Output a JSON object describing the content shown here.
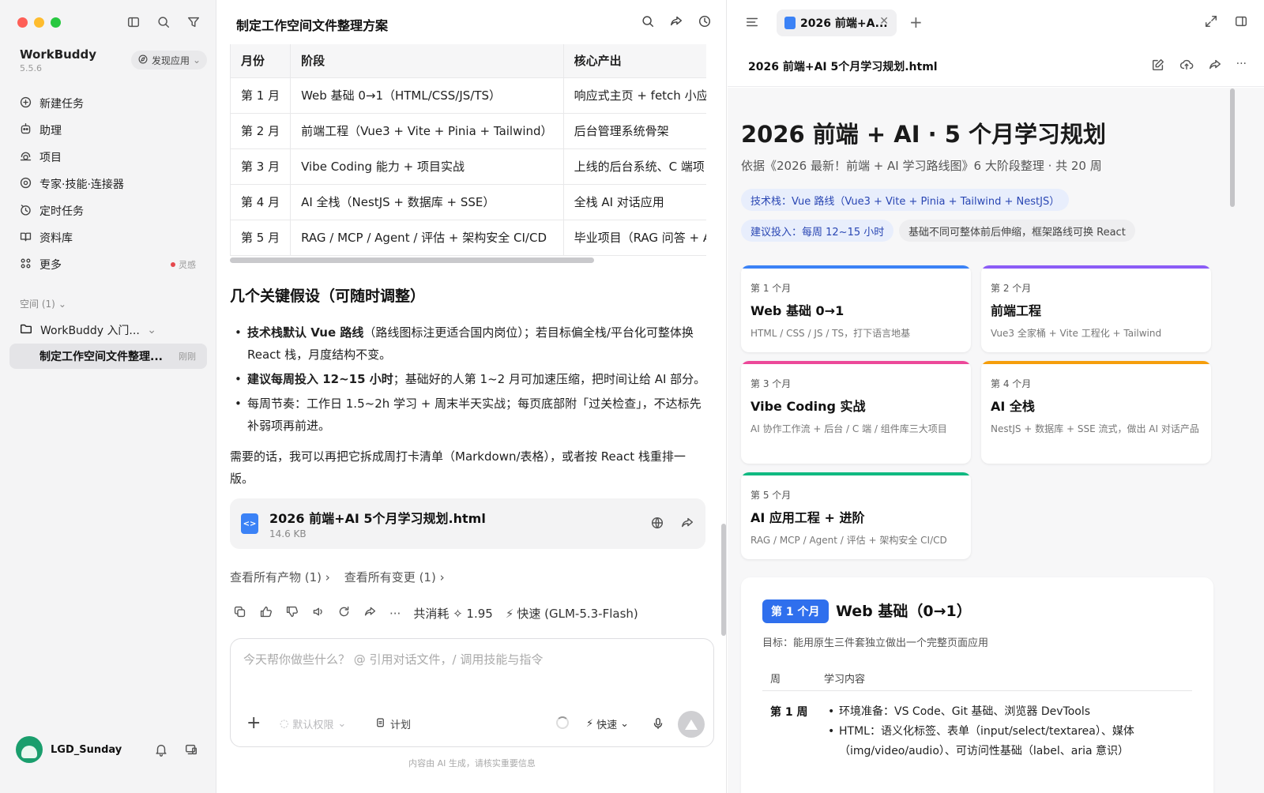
{
  "sidebar": {
    "brand": "WorkBuddy",
    "version": "5.5.6",
    "discover_label": "发现应用",
    "nav": [
      {
        "label": "新建任务"
      },
      {
        "label": "助理"
      },
      {
        "label": "项目"
      },
      {
        "label": "专家·技能·连接器"
      },
      {
        "label": "定时任务"
      },
      {
        "label": "资料库"
      },
      {
        "label": "更多",
        "badge": "灵感"
      }
    ],
    "space_label": "空间 (1)",
    "folder_label": "WorkBuddy 入门...",
    "task": {
      "label": "制定工作空间文件整理...",
      "time": "刚刚"
    },
    "user": {
      "name": "LGD_Sunday"
    }
  },
  "chat": {
    "title": "制定工作空间文件整理方案",
    "table": {
      "headers": [
        "月份",
        "阶段",
        "核心产出"
      ],
      "rows": [
        [
          "第 1 月",
          "Web 基础 0→1（HTML/CSS/JS/TS）",
          "响应式主页 + fetch 小应用"
        ],
        [
          "第 2 月",
          "前端工程（Vue3 + Vite + Pinia + Tailwind）",
          "后台管理系统骨架"
        ],
        [
          "第 3 月",
          "Vibe Coding 能力 + 项目实战",
          "上线的后台系统、C 端项目"
        ],
        [
          "第 4 月",
          "AI 全栈（NestJS + 数据库 + SSE）",
          "全栈 AI 对话应用"
        ],
        [
          "第 5 月",
          "RAG / MCP / Agent / 评估 + 架构安全 CI/CD",
          "毕业项目（RAG 问答 + Age"
        ]
      ]
    },
    "assumptions_title": "几个关键假设（可随时调整）",
    "bullets": [
      {
        "bold": "技术栈默认 Vue 路线",
        "text": "（路线图标注更适合国内岗位）；若目标偏全栈/平台化可整体换 React 栈，月度结构不变。"
      },
      {
        "bold": "建议每周投入 12~15 小时",
        "text": "；基础好的人第 1~2 月可加速压缩，把时间让给 AI 部分。"
      },
      {
        "bold": "",
        "text": "每周节奏：工作日 1.5~2h 学习 + 周末半天实战；每页底部附「过关检查」，不达标先补弱项再前进。"
      }
    ],
    "closing": "需要的话，我可以再把它拆成周打卡清单（Markdown/表格），或者按 React 栈重排一版。",
    "file": {
      "name": "2026 前端+AI 5个月学习规划.html",
      "size": "14.6 KB"
    },
    "links": [
      "查看所有产物 (1) ›",
      "查看所有变更 (1) ›"
    ],
    "cost": "共消耗 ✧ 1.95",
    "model": "快速 (GLM-5.3-Flash)",
    "composer": {
      "placeholder": "今天帮你做些什么？ @ 引用对话文件，/ 调用技能与指令",
      "perm_label": "默认权限",
      "plan_label": "计划",
      "speed_label": "快速"
    },
    "disclaimer": "内容由 AI 生成，请核实重要信息"
  },
  "preview": {
    "tab_label": "2026 前端+A...",
    "filename": "2026 前端+AI 5个月学习规划.html",
    "doc": {
      "title": "2026 前端 + AI · 5 个月学习规划",
      "subtitle": "依据《2026 最新！前端 + AI 学习路线图》6 大阶段整理 · 共 20 周",
      "pills": [
        {
          "text": "技术栈：Vue 路线（Vue3 + Vite + Pinia + Tailwind + NestJS）",
          "style": "blue"
        },
        {
          "text": "建议投入：每周 12~15 小时",
          "style": "blue"
        },
        {
          "text": "基础不同可整体前后伸缩，框架路线可换 React",
          "style": "gray"
        }
      ],
      "months": [
        {
          "month": "第 1 个月",
          "title": "Web 基础 0→1",
          "desc": "HTML / CSS / JS / TS，打下语言地基",
          "color": "#3b82f6"
        },
        {
          "month": "第 2 个月",
          "title": "前端工程",
          "desc": "Vue3 全家桶 + Vite 工程化 + Tailwind",
          "color": "#8b5cf6"
        },
        {
          "month": "第 3 个月",
          "title": "Vibe Coding 实战",
          "desc": "AI 协作工作流 + 后台 / C 端 / 组件库三大项目",
          "color": "#ec4899"
        },
        {
          "month": "第 4 个月",
          "title": "AI 全栈",
          "desc": "NestJS + 数据库 + SSE 流式，做出 AI 对话产品",
          "color": "#f59e0b"
        },
        {
          "month": "第 5 个月",
          "title": "AI 应用工程 + 进阶",
          "desc": "RAG / MCP / Agent / 评估 + 架构安全 CI/CD",
          "color": "#10b981"
        }
      ],
      "detail": {
        "badge": "第 1 个月",
        "title": "Web 基础（0→1）",
        "goal": "目标：能用原生三件套独立做出一个完整页面应用",
        "col_week": "周",
        "col_content": "学习内容",
        "week": "第 1 周",
        "items": [
          "环境准备：VS Code、Git 基础、浏览器 DevTools",
          "HTML：语义化标签、表单（input/select/textarea）、媒体（img/video/audio）、可访问性基础（label、aria 意识）"
        ]
      }
    }
  }
}
